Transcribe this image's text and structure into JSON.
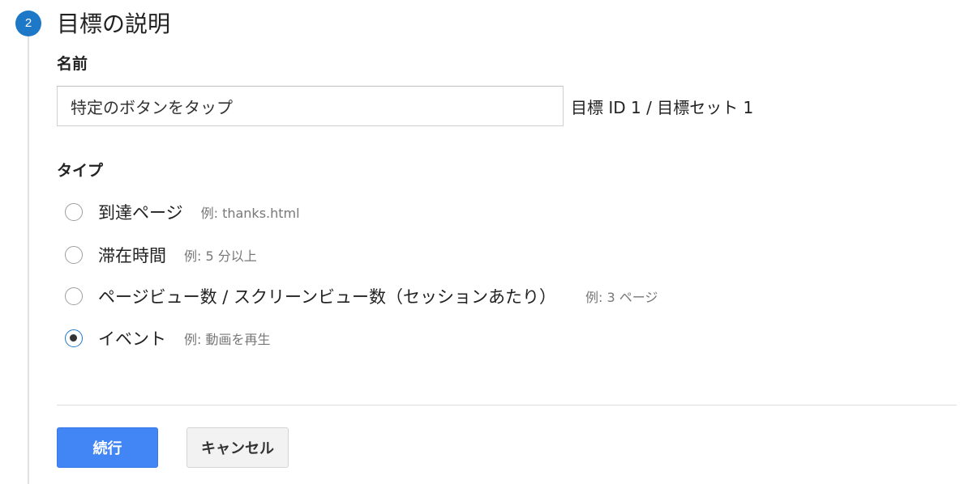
{
  "step": {
    "number": "2",
    "title": "目標の説明"
  },
  "name_field": {
    "label": "名前",
    "value": "特定のボタンをタップ",
    "goal_id_text": "目標 ID 1 / 目標セット 1"
  },
  "type_field": {
    "label": "タイプ",
    "options": [
      {
        "label": "到達ページ",
        "example": "例: thanks.html",
        "selected": false
      },
      {
        "label": "滞在時間",
        "example": "例: 5 分以上",
        "selected": false
      },
      {
        "label": "ページビュー数 / スクリーンビュー数（セッションあたり）",
        "example": "例: 3 ページ",
        "selected": false
      },
      {
        "label": "イベント",
        "example": "例: 動画を再生",
        "selected": true
      }
    ]
  },
  "buttons": {
    "continue_label": "続行",
    "cancel_label": "キャンセル"
  },
  "colors": {
    "accent": "#4285f4",
    "step_badge": "#1e78c8"
  }
}
